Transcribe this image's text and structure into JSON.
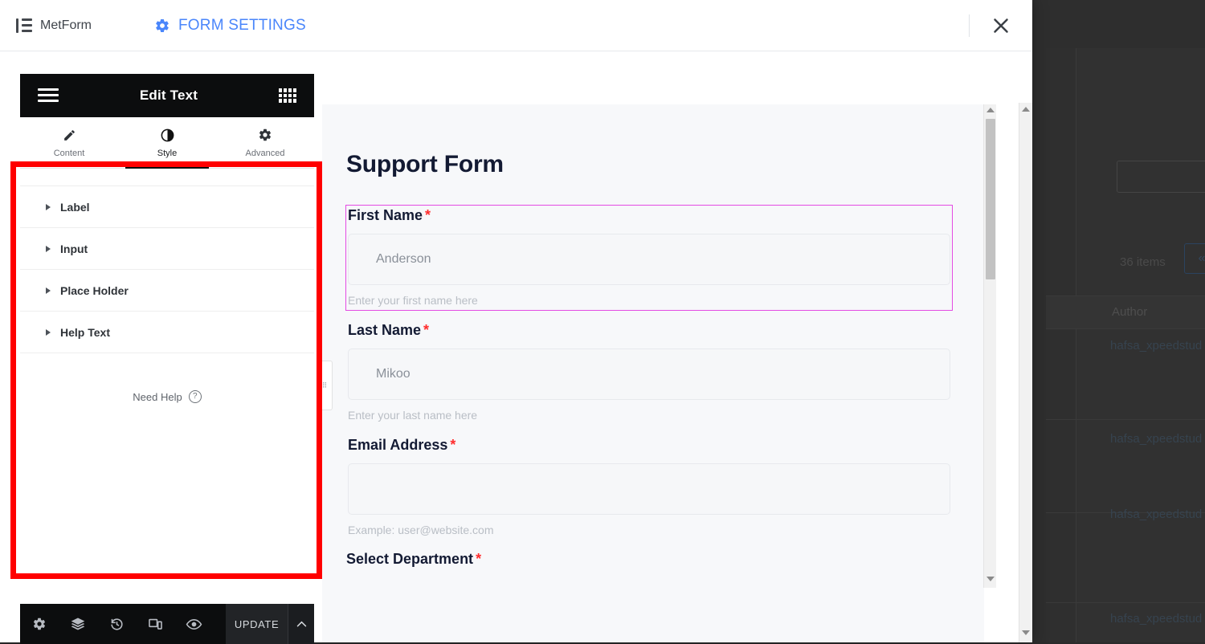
{
  "header": {
    "brand": "MetForm",
    "brand_icon": "list-icon",
    "form_settings_label": "FORM SETTINGS",
    "form_settings_icon": "gear-icon",
    "close_icon": "close-icon",
    "accent_blue": "#4a86fb"
  },
  "editor": {
    "panel_title": "Edit Text",
    "menu_icon": "hamburger-icon",
    "widgets_icon": "grid-icon",
    "tabs": [
      {
        "label": "Content",
        "icon": "pencil-icon",
        "active": false
      },
      {
        "label": "Style",
        "icon": "contrast-icon",
        "active": true
      },
      {
        "label": "Advanced",
        "icon": "gear-icon",
        "active": false
      }
    ],
    "sections": [
      {
        "label": "Label"
      },
      {
        "label": "Input"
      },
      {
        "label": "Place Holder"
      },
      {
        "label": "Help Text"
      }
    ],
    "need_help": "Need Help",
    "need_help_icon": "question-circle-icon",
    "handle_icon": "drag-handle-icon",
    "highlight_color": "#ff0000"
  },
  "bottom_bar": {
    "icons": [
      {
        "name": "settings-gear-icon"
      },
      {
        "name": "layers-navigator-icon"
      },
      {
        "name": "history-icon"
      },
      {
        "name": "responsive-preview-icon"
      },
      {
        "name": "eye-preview-icon"
      }
    ],
    "update_label": "UPDATE",
    "caret_icon": "chevron-up-icon"
  },
  "preview": {
    "form_title": "Support Form",
    "selected_field_color": "#e34be3",
    "required_mark": "*",
    "fields": [
      {
        "label": "First Name",
        "required": true,
        "value": "Anderson",
        "help": "Enter your first name here",
        "selected": true
      },
      {
        "label": "Last Name",
        "required": true,
        "value": "Mikoo",
        "help": "Enter your last name here",
        "selected": false
      },
      {
        "label": "Email Address",
        "required": true,
        "value": "",
        "help": "Example: user@website.com",
        "selected": false
      }
    ],
    "cut_off_label": "Select Department",
    "cut_off_required": "*"
  },
  "backdrop": {
    "items_count": "36 items",
    "page_prev_label": "«",
    "column_author": "Author",
    "authors": [
      "hafsa_xpeedstud",
      "hafsa_xpeedstud",
      "hafsa_xpeedstud",
      "hafsa_xpeedstud"
    ]
  },
  "scrollbars": {
    "up_icon": "triangle-up-icon",
    "down_icon": "triangle-down-icon"
  }
}
